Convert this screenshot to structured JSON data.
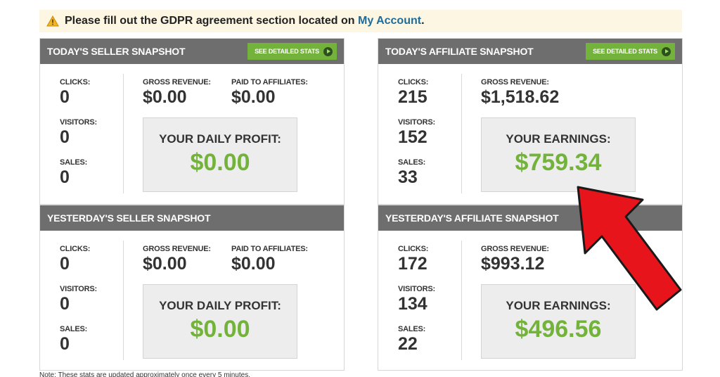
{
  "notice": {
    "text": "Please fill out the GDPR agreement section located on ",
    "link": "My Account",
    "suffix": "."
  },
  "panels": {
    "seller_today": {
      "title": "TODAY'S SELLER SNAPSHOT",
      "button": "SEE DETAILED STATS",
      "clicks_label": "CLICKS:",
      "clicks": "0",
      "visitors_label": "VISITORS:",
      "visitors": "0",
      "sales_label": "SALES:",
      "sales": "0",
      "gross_label": "GROSS REVENUE:",
      "gross": "$0.00",
      "paid_label": "PAID TO AFFILIATES:",
      "paid": "$0.00",
      "box_label": "YOUR DAILY PROFIT:",
      "box_value": "$0.00"
    },
    "affiliate_today": {
      "title": "TODAY'S AFFILIATE SNAPSHOT",
      "button": "SEE DETAILED STATS",
      "clicks_label": "CLICKS:",
      "clicks": "215",
      "visitors_label": "VISITORS:",
      "visitors": "152",
      "sales_label": "SALES:",
      "sales": "33",
      "gross_label": "GROSS REVENUE:",
      "gross": "$1,518.62",
      "box_label": "YOUR EARNINGS:",
      "box_value": "$759.34"
    },
    "seller_yesterday": {
      "title": "YESTERDAY'S SELLER SNAPSHOT",
      "clicks_label": "CLICKS:",
      "clicks": "0",
      "visitors_label": "VISITORS:",
      "visitors": "0",
      "sales_label": "SALES:",
      "sales": "0",
      "gross_label": "GROSS REVENUE:",
      "gross": "$0.00",
      "paid_label": "PAID TO AFFILIATES:",
      "paid": "$0.00",
      "box_label": "YOUR DAILY PROFIT:",
      "box_value": "$0.00"
    },
    "affiliate_yesterday": {
      "title": "YESTERDAY'S AFFILIATE SNAPSHOT",
      "clicks_label": "CLICKS:",
      "clicks": "172",
      "visitors_label": "VISITORS:",
      "visitors": "134",
      "sales_label": "SALES:",
      "sales": "22",
      "gross_label": "GROSS REVENUE:",
      "gross": "$993.12",
      "box_label": "YOUR EARNINGS:",
      "box_value": "$496.56"
    }
  },
  "footer_note": "Note: These stats are updated approximately once every 5 minutes.",
  "icons": {
    "warning": "warning-icon",
    "play": "play-circle-icon",
    "arrow": "red-arrow-icon"
  },
  "colors": {
    "accent_green": "#74b33b",
    "header_gray": "#6e6e6e",
    "link_blue": "#1f6b9a",
    "arrow_red": "#e8141b"
  }
}
